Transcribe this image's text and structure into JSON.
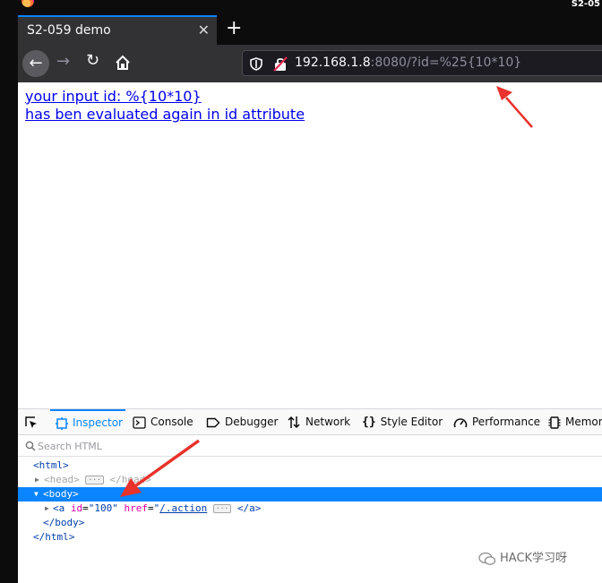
{
  "window": {
    "title_fragment": "S2-05"
  },
  "tabs": [
    {
      "title": "S2-059 demo",
      "active": true
    }
  ],
  "toolbar": {
    "back_glyph": "←",
    "forward_glyph": "→",
    "reload_glyph": "↻",
    "close_glyph": "✕",
    "new_tab_glyph": "+"
  },
  "urlbar": {
    "host": "192.168.1.8",
    "rest": ":8080/?id=%25{10*10}"
  },
  "page": {
    "links": [
      "your input id: %{10*10}",
      "has ben evaluated again in id attribute"
    ]
  },
  "devtools": {
    "tabs": [
      {
        "label": "Inspector",
        "icon": "inspector-icon",
        "active": true
      },
      {
        "label": "Console",
        "icon": "console-icon"
      },
      {
        "label": "Debugger",
        "icon": "debugger-icon"
      },
      {
        "label": "Network",
        "icon": "network-icon"
      },
      {
        "label": "Style Editor",
        "icon": "style-editor-icon"
      },
      {
        "label": "Performance",
        "icon": "performance-icon"
      },
      {
        "label": "Memor",
        "icon": "memory-icon"
      }
    ],
    "search": {
      "placeholder": "Search HTML"
    },
    "tree": {
      "html_open": "<html>",
      "head_open": "<head>",
      "head_close": "</head>",
      "body_open": "<body>",
      "a_open": "<a",
      "a_id_name": "id",
      "a_id_value": "\"100\"",
      "a_href_name": "href",
      "a_href_q": "\"",
      "a_href_value": "/.action",
      "a_close": "</a>",
      "body_close": "</body>",
      "html_close": "</html>",
      "ellipsis": "···"
    }
  },
  "watermark": {
    "text": "HACK学习呀"
  },
  "colors": {
    "accent": "#0a84ff",
    "arrow": "#e8322b",
    "link": "#0000ee"
  }
}
